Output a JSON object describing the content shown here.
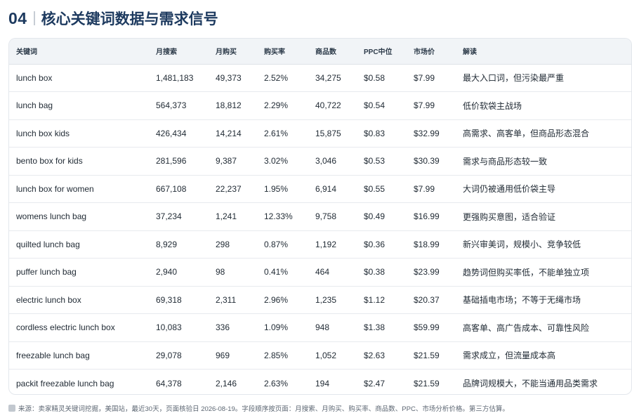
{
  "header": {
    "number": "04",
    "title": "核心关键词数据与需求信号"
  },
  "table": {
    "columns": [
      "关键词",
      "月搜索",
      "月购买",
      "购买率",
      "商品数",
      "PPC中位",
      "市场价",
      "解读"
    ],
    "rows": [
      [
        "lunch box",
        "1,481,183",
        "49,373",
        "2.52%",
        "34,275",
        "$0.58",
        "$7.99",
        "最大入口词，但污染最严重"
      ],
      [
        "lunch bag",
        "564,373",
        "18,812",
        "2.29%",
        "40,722",
        "$0.54",
        "$7.99",
        "低价软袋主战场"
      ],
      [
        "lunch box kids",
        "426,434",
        "14,214",
        "2.61%",
        "15,875",
        "$0.83",
        "$32.99",
        "高需求、高客单，但商品形态混合"
      ],
      [
        "bento box for kids",
        "281,596",
        "9,387",
        "3.02%",
        "3,046",
        "$0.53",
        "$30.39",
        "需求与商品形态较一致"
      ],
      [
        "lunch box for women",
        "667,108",
        "22,237",
        "1.95%",
        "6,914",
        "$0.55",
        "$7.99",
        "大词仍被通用低价袋主导"
      ],
      [
        "womens lunch bag",
        "37,234",
        "1,241",
        "12.33%",
        "9,758",
        "$0.49",
        "$16.99",
        "更强购买意图，适合验证"
      ],
      [
        "quilted lunch bag",
        "8,929",
        "298",
        "0.87%",
        "1,192",
        "$0.36",
        "$18.99",
        "新兴审美词，规模小、竞争较低"
      ],
      [
        "puffer lunch bag",
        "2,940",
        "98",
        "0.41%",
        "464",
        "$0.38",
        "$23.99",
        "趋势词但购买率低，不能单独立项"
      ],
      [
        "electric lunch box",
        "69,318",
        "2,311",
        "2.96%",
        "1,235",
        "$1.12",
        "$20.37",
        "基础插电市场；不等于无绳市场"
      ],
      [
        "cordless electric lunch box",
        "10,083",
        "336",
        "1.09%",
        "948",
        "$1.38",
        "$59.99",
        "高客单、高广告成本、可靠性风险"
      ],
      [
        "freezable lunch bag",
        "29,078",
        "969",
        "2.85%",
        "1,052",
        "$2.63",
        "$21.59",
        "需求成立，但流量成本高"
      ],
      [
        "packit freezable lunch bag",
        "64,378",
        "2,146",
        "2.63%",
        "194",
        "$2.47",
        "$21.59",
        "品牌词规模大，不能当通用品类需求"
      ]
    ]
  },
  "footnote": {
    "text": "来源：卖家精灵关键词挖掘，美国站，最近30天，页面核验日 2026-08-19。字段顺序按页面：月搜索、月购买、购买率、商品数、PPC、市场分析价格。第三方估算。"
  }
}
